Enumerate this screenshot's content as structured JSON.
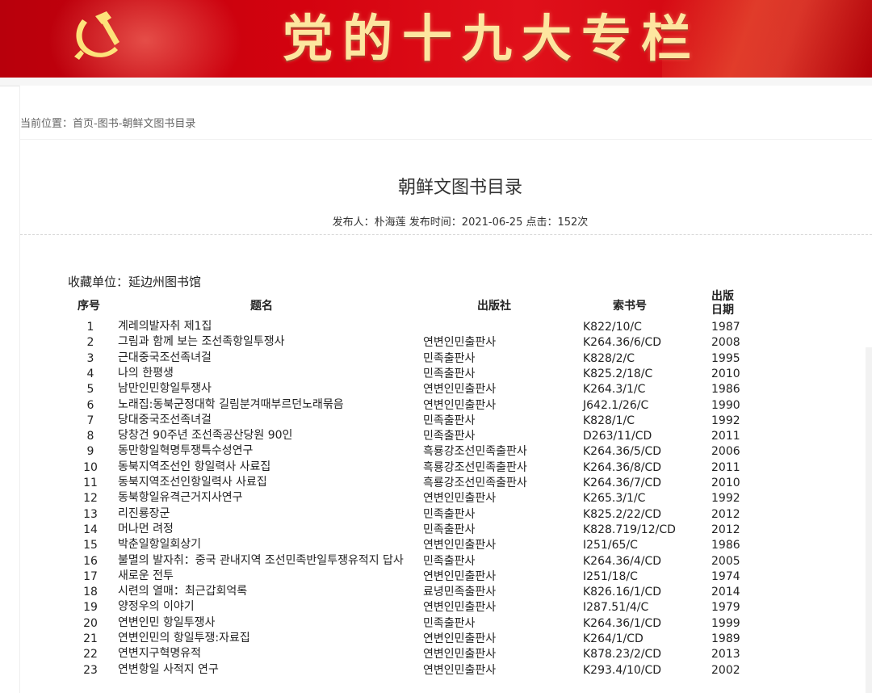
{
  "banner": {
    "title": "党的十九大专栏"
  },
  "breadcrumb": "当前位置：首页-图书-朝鲜文图书目录",
  "article": {
    "title": "朝鲜文图书目录",
    "meta": "发布人：朴海莲 发布时间：2021-06-25 点击：152次",
    "holding": "收藏单位：延边州图书馆"
  },
  "table": {
    "headers": {
      "num": "序号",
      "title": "题名",
      "publisher": "出版社",
      "call": "索书号",
      "date1": "出版",
      "date2": "日期"
    },
    "rows": [
      {
        "num": "1",
        "title": "계레의발자취 제1집",
        "publisher": "",
        "call": "K822/10/C",
        "date": "1987"
      },
      {
        "num": "2",
        "title": "그림과 함께 보는 조선족항일투쟁사",
        "publisher": "연변인민출판사",
        "call": "K264.36/6/CD",
        "date": "2008"
      },
      {
        "num": "3",
        "title": "근대중국조선족녀걸",
        "publisher": "민족출판사",
        "call": "K828/2/C",
        "date": "1995"
      },
      {
        "num": "4",
        "title": "나의 한평생",
        "publisher": "민족출판사",
        "call": "K825.2/18/C",
        "date": "2010"
      },
      {
        "num": "5",
        "title": "남만인민항일투쟁사",
        "publisher": "연변인민출판사",
        "call": "K264.3/1/C",
        "date": "1986"
      },
      {
        "num": "6",
        "title": "노래집:동북군정대학 길림분겨때부르던노래묶음",
        "publisher": "연변인민출판사",
        "call": "J642.1/26/C",
        "date": "1990"
      },
      {
        "num": "7",
        "title": "당대중국조선족녀걸",
        "publisher": "민족출판사",
        "call": "K828/1/C",
        "date": "1992"
      },
      {
        "num": "8",
        "title": "당창건 90주년 조선족공산당원 90인",
        "publisher": "민족출판사",
        "call": "D263/11/CD",
        "date": "2011"
      },
      {
        "num": "9",
        "title": "동만항일혁명투쟁특수성연구",
        "publisher": "흑룡강조선민족출판사",
        "call": "K264.36/5/CD",
        "date": "2006"
      },
      {
        "num": "10",
        "title": "동북지역조선인 항일력사 사료집",
        "publisher": "흑룡강조선민족출판사",
        "call": "K264.36/8/CD",
        "date": "2011"
      },
      {
        "num": "11",
        "title": "동북지역조선인항일력사 사료집",
        "publisher": "흑룡강조선민족출판사",
        "call": "K264.36/7/CD",
        "date": "2010"
      },
      {
        "num": "12",
        "title": "동북항일유격근거지사연구",
        "publisher": "연변인민출판사",
        "call": "K265.3/1/C",
        "date": "1992"
      },
      {
        "num": "13",
        "title": "리진룡장군",
        "publisher": "민족출판사",
        "call": "K825.2/22/CD",
        "date": "2012"
      },
      {
        "num": "14",
        "title": "머나먼 려정",
        "publisher": "민족출판사",
        "call": "K828.719/12/CD",
        "date": "2012"
      },
      {
        "num": "15",
        "title": "박춘일항일회상기",
        "publisher": "연변인민출판사",
        "call": "I251/65/C",
        "date": "1986"
      },
      {
        "num": "16",
        "title": "불멸의 발자취：중국 관내지역 조선민족반일투쟁유적지 답사",
        "publisher": "민족출판사",
        "call": "K264.36/4/CD",
        "date": "2005"
      },
      {
        "num": "17",
        "title": "새로운 전투",
        "publisher": "연변인민출판사",
        "call": "I251/18/C",
        "date": "1974"
      },
      {
        "num": "18",
        "title": "시련의 열매：최근갑회억록",
        "publisher": "료녕민족출판사",
        "call": "K826.16/1/CD",
        "date": "2014"
      },
      {
        "num": "19",
        "title": "양정우의 이야기",
        "publisher": "연변인민출판사",
        "call": "I287.51/4/C",
        "date": "1979"
      },
      {
        "num": "20",
        "title": "연변인민 항일투쟁사",
        "publisher": "민족출판사",
        "call": "K264.36/1/CD",
        "date": "1999"
      },
      {
        "num": "21",
        "title": "연변인민의 항일투쟁:자료집",
        "publisher": "연변인민출판사",
        "call": "K264/1/CD",
        "date": "1989"
      },
      {
        "num": "22",
        "title": "연변지구혁명유적",
        "publisher": "연변인민출판사",
        "call": "K878.23/2/CD",
        "date": "2013"
      },
      {
        "num": "23",
        "title": "연변항일 사적지 연구",
        "publisher": "연변인민출판사",
        "call": "K293.4/10/CD",
        "date": "2002"
      }
    ]
  }
}
